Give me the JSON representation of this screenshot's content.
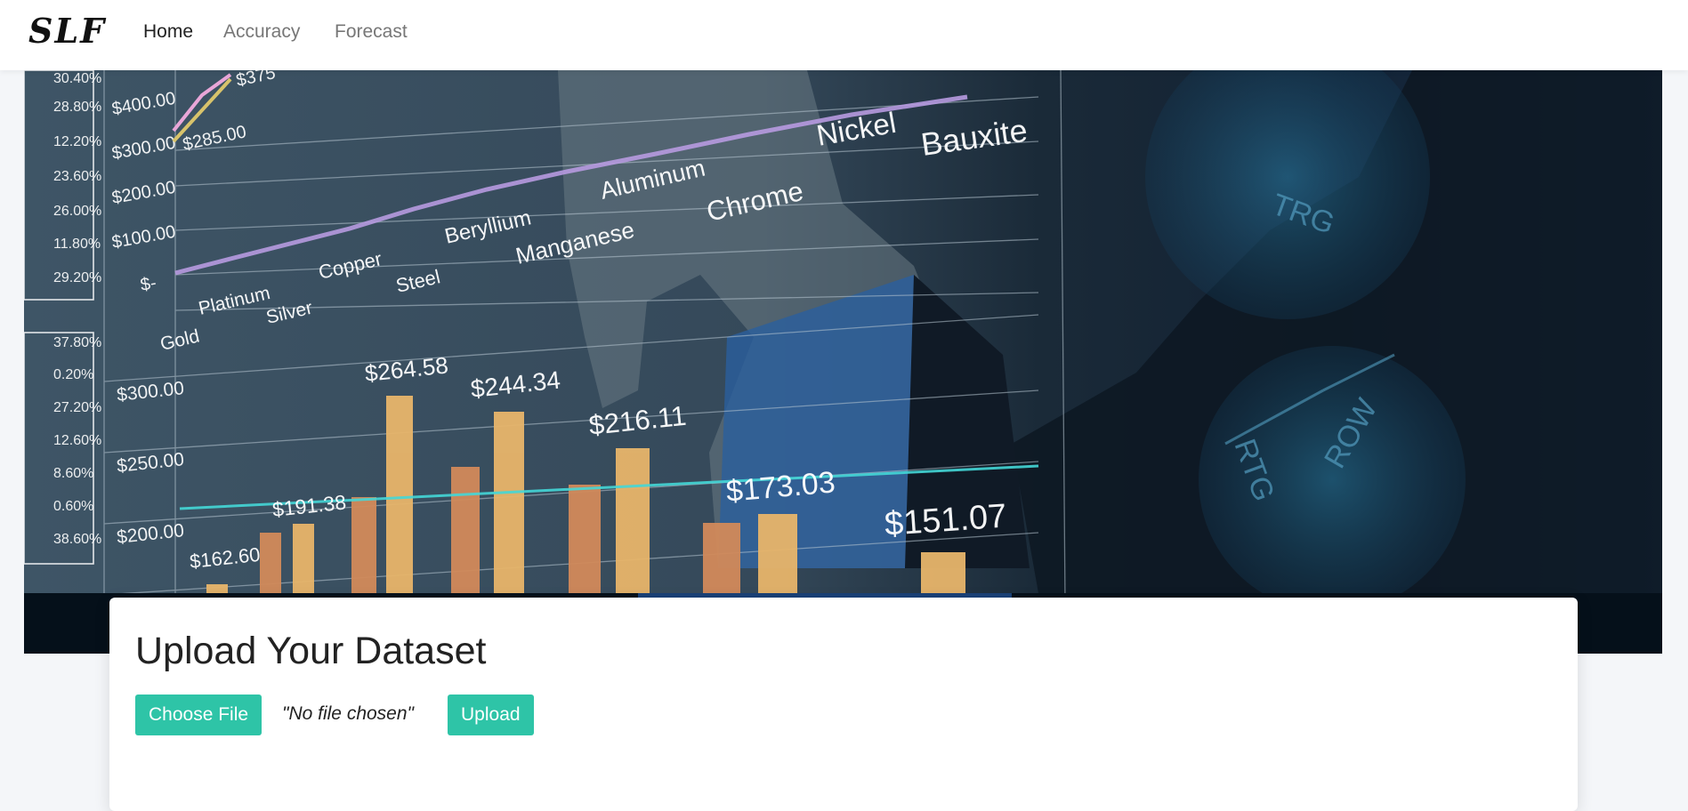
{
  "navbar": {
    "brand": "SLF",
    "items": [
      {
        "label": "Home",
        "active": true
      },
      {
        "label": "Accuracy",
        "active": false
      },
      {
        "label": "Forecast",
        "active": false
      }
    ]
  },
  "hero": {
    "image_text": {
      "metals": [
        "Gold",
        "Platinum",
        "Silver",
        "Copper",
        "Steel",
        "Beryllium",
        "Manganese",
        "Aluminum",
        "Chrome",
        "Nickel",
        "Bauxite"
      ],
      "upper_axis": [
        "$400.00",
        "$300.00",
        "$200.00",
        "$100.00",
        "$-"
      ],
      "upper_values": [
        "$285.00",
        "$375"
      ],
      "lower_axis": [
        "$300.00",
        "$250.00",
        "$200.00"
      ],
      "bar_values": [
        "$162.60",
        "$191.38",
        "$264.58",
        "$244.34",
        "$216.11",
        "$173.03",
        "$151.07"
      ],
      "left_percents_top": [
        "30.40%",
        "28.80%",
        "12.20%",
        "23.60%",
        "26.00%",
        "11.80%",
        "29.20%"
      ],
      "left_percents_bottom": [
        "37.80%",
        "0.20%",
        "27.20%",
        "12.60%",
        "8.60%",
        "0.60%",
        "38.60%"
      ],
      "pie_labels": [
        "TRG",
        "RTG",
        "ROW"
      ]
    },
    "colors": {
      "bar_fill": "#e8b56a",
      "trend_line": "#44d7d7",
      "purple_line": "#b79ae0",
      "panel_bg": "#34495a"
    }
  },
  "upload_card": {
    "title": "Upload Your Dataset",
    "choose_label": "Choose File",
    "file_status": "\"No file chosen\"",
    "upload_label": "Upload",
    "accent": "#2ec4a7"
  }
}
